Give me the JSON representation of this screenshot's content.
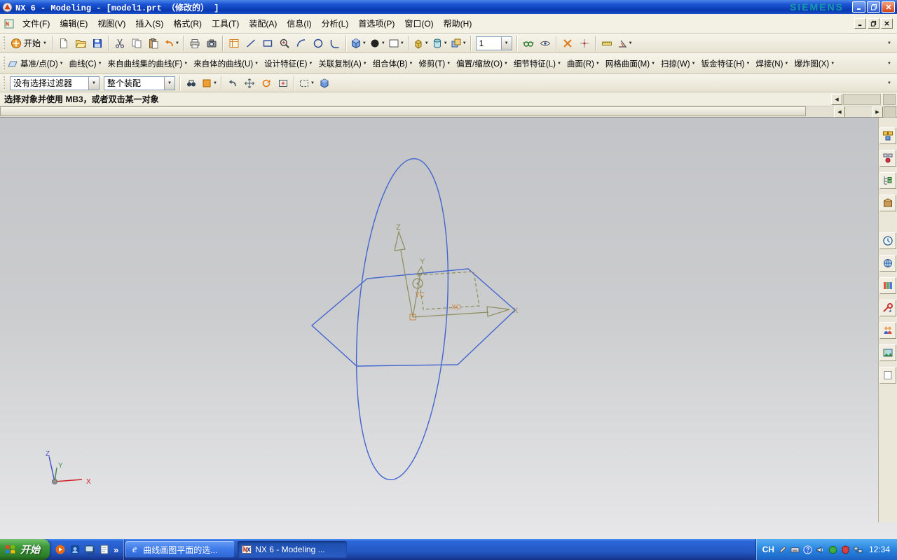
{
  "titlebar": {
    "title": "NX 6 - Modeling - [model1.prt （修改的） ]",
    "brand": "SIEMENS"
  },
  "menubar": {
    "items": [
      "文件(F)",
      "编辑(E)",
      "视图(V)",
      "插入(S)",
      "格式(R)",
      "工具(T)",
      "装配(A)",
      "信息(I)",
      "分析(L)",
      "首选项(P)",
      "窗口(O)",
      "帮助(H)"
    ]
  },
  "toolbar_standard": {
    "start_label": "开始",
    "layer_value": "1",
    "icons": [
      "new-file",
      "open",
      "save",
      "cut",
      "copy",
      "paste",
      "undo",
      "print",
      "snapshot",
      "sketch",
      "line",
      "rectangle",
      "zoom",
      "arc",
      "circle",
      "fillet",
      "render-style",
      "orbit",
      "background",
      "extrude",
      "revolve",
      "boolean",
      "layer-combo",
      "glasses",
      "visibility",
      "snap-cross",
      "snap-point",
      "measure-distance",
      "measure-angle"
    ]
  },
  "toolbar_features": {
    "items": [
      "基准/点(D)",
      "曲线(C)",
      "来自曲线集的曲线(F)",
      "来自体的曲线(U)",
      "设计特征(E)",
      "关联复制(A)",
      "组合体(B)",
      "修剪(T)",
      "偏置/缩放(O)",
      "细节特征(L)",
      "曲面(R)",
      "网格曲面(M)",
      "扫掠(W)",
      "钣金特征(H)",
      "焊接(N)",
      "爆炸图(X)"
    ]
  },
  "selection_bar": {
    "filter_value": "没有选择过滤器",
    "scope_value": "整个装配",
    "icons": [
      "find",
      "selection-priority",
      "previous-selection",
      "pan-view",
      "rotate-view",
      "fit-view",
      "rectangle-select",
      "shaded-cube"
    ]
  },
  "prompt": {
    "text": "选择对象并使用 MB3，或者双击某一对象"
  },
  "viewport": {
    "csys_labels": {
      "x": "X",
      "y": "Y",
      "z": "Z",
      "xc": "XC",
      "yc": "YC"
    },
    "triad_labels": {
      "x": "X",
      "y": "Y",
      "z": "Z"
    },
    "colors": {
      "curve": "#4365cf",
      "csys": "#8d8d5e",
      "wcs_label": "#cc8440",
      "triad_x": "#cc2020",
      "triad_y": "#4a8a55",
      "triad_z": "#4253c4"
    }
  },
  "resource_bar": {
    "icons": [
      "assembly-navigator",
      "constraint-navigator",
      "part-navigator",
      "reuse-library",
      "history",
      "web-browser",
      "hd3d-tools",
      "process-studio",
      "roles",
      "scene-materials",
      "touch-mode"
    ]
  },
  "taskbar": {
    "start_label": "开始",
    "quick_launch_icons": [
      "media-player",
      "messenger",
      "show-desktop",
      "notes"
    ],
    "overflow_glyph": "»",
    "tasks": [
      {
        "label": "曲线画图平面的选...",
        "icon": "internet-explorer",
        "icon_glyph": "e",
        "active": false
      },
      {
        "label": "NX 6 - Modeling ...",
        "icon": "nx-document",
        "active": true
      }
    ],
    "tray": {
      "lang": "CH",
      "time": "12:34",
      "icons": [
        "pen",
        "keyboard",
        "help",
        "volume",
        "status-green",
        "shield",
        "network"
      ]
    }
  }
}
